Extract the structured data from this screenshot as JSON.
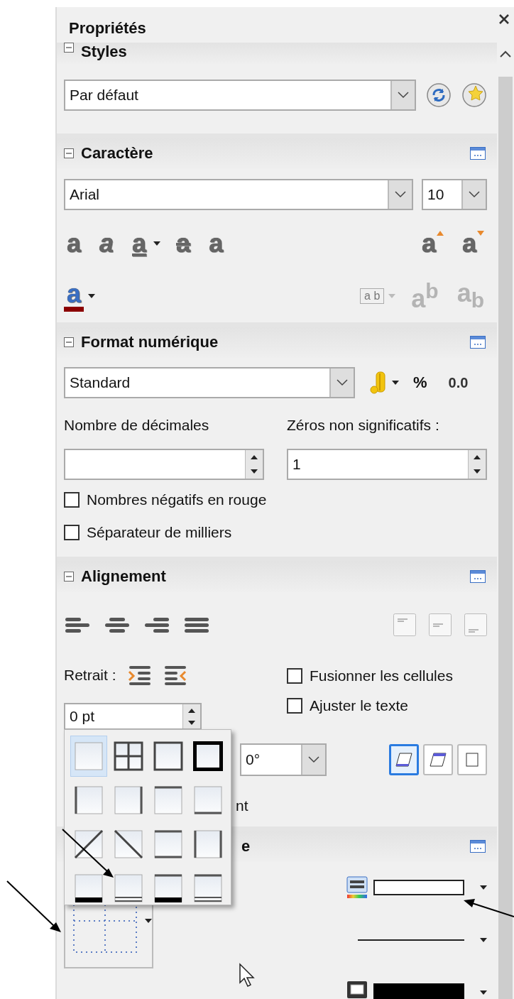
{
  "panel": {
    "title": "Propriétés"
  },
  "styles": {
    "title": "Styles",
    "expanded": true,
    "value": "Par défaut"
  },
  "character": {
    "title": "Caractère",
    "expanded": true,
    "font": "Arial",
    "size": "10",
    "row1_left": [
      {
        "kind": "bold",
        "glyph": "a",
        "disabled": false,
        "dropdown": false
      },
      {
        "kind": "italic",
        "glyph": "a",
        "disabled": false,
        "dropdown": false
      },
      {
        "kind": "underline",
        "glyph": "a",
        "disabled": false,
        "dropdown": true
      },
      {
        "kind": "strike",
        "glyph": "a",
        "disabled": false,
        "dropdown": false
      },
      {
        "kind": "shadow",
        "glyph": "a",
        "disabled": false,
        "dropdown": false
      }
    ],
    "row1_right": [
      {
        "kind": "grow",
        "glyph": "a",
        "disabled": false,
        "dropdown": false
      },
      {
        "kind": "shrink",
        "glyph": "a",
        "disabled": false,
        "dropdown": false
      }
    ],
    "row2_left": [
      {
        "kind": "color",
        "glyph": "a",
        "disabled": false,
        "dropdown": true
      }
    ],
    "row2_right": [
      {
        "kind": "spacing",
        "glyph": "a b",
        "disabled": true,
        "dropdown": true
      },
      {
        "kind": "super",
        "glyph": "a$^{b}$",
        "disabled": true,
        "dropdown": false
      },
      {
        "kind": "sub",
        "glyph": "a$_{b}$",
        "disabled": true,
        "dropdown": false
      }
    ]
  },
  "number_format": {
    "title": "Format numérique",
    "expanded": true,
    "format": "Standard",
    "percent": "%",
    "decimal": "0.0",
    "decimals_label": "Nombre de décimales",
    "zeros_label": "Zéros non significatifs :",
    "zeros_value": "1",
    "checkboxes": [
      {
        "label": "Nombres négatifs en rouge",
        "checked": false
      },
      {
        "label": "Séparateur de milliers",
        "checked": false
      }
    ]
  },
  "alignment": {
    "title": "Alignement",
    "expanded": true,
    "indent_label": "Retrait :",
    "indent_value": "0 pt",
    "checkboxes": [
      {
        "label": "Fusionner les cellules",
        "checked": false
      },
      {
        "label": "Ajuster le texte",
        "checked": false
      }
    ],
    "rotation": "0°",
    "orientation_buttons": [
      {
        "selected": true
      },
      {
        "selected": false
      },
      {
        "selected": false
      }
    ],
    "partial_label": "nt"
  },
  "appearance": {
    "partial_title": "e"
  },
  "border_popup": {
    "options": [
      {
        "selected": true
      },
      {
        "selected": false
      },
      {
        "selected": false
      },
      {
        "selected": false
      },
      {
        "selected": false
      },
      {
        "selected": false
      },
      {
        "selected": false
      },
      {
        "selected": false
      },
      {
        "selected": false
      },
      {
        "selected": false
      },
      {
        "selected": false
      },
      {
        "selected": false
      },
      {
        "selected": false
      },
      {
        "selected": false
      },
      {
        "selected": false
      },
      {
        "selected": false
      }
    ]
  }
}
